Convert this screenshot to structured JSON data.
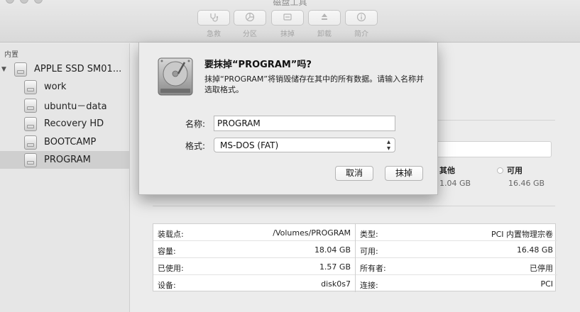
{
  "window": {
    "title": "磁盘工具"
  },
  "toolbar": {
    "buttons": [
      {
        "label": "急救",
        "icon": "stethoscope-icon"
      },
      {
        "label": "分区",
        "icon": "partition-pie-icon"
      },
      {
        "label": "抹掉",
        "icon": "erase-icon"
      },
      {
        "label": "卸载",
        "icon": "unmount-icon"
      },
      {
        "label": "简介",
        "icon": "info-icon"
      }
    ]
  },
  "sidebar": {
    "section_header": "内置",
    "device": "APPLE SSD SM01...",
    "items": [
      {
        "label": "work"
      },
      {
        "label": "ubuntu－data"
      },
      {
        "label": "Recovery HD"
      },
      {
        "label": "BOOTCAMP"
      },
      {
        "label": "PROGRAM"
      }
    ],
    "selected": "PROGRAM"
  },
  "usage": {
    "other_label": "其他",
    "other_value": "1.04 GB",
    "free_label": "可用",
    "free_value": "16.46 GB"
  },
  "info": {
    "left": [
      {
        "key": "装载点:",
        "value": "/Volumes/PROGRAM"
      },
      {
        "key": "容量:",
        "value": "18.04 GB"
      },
      {
        "key": "已使用:",
        "value": "1.57 GB"
      },
      {
        "key": "设备:",
        "value": "disk0s7"
      }
    ],
    "right": [
      {
        "key": "类型:",
        "value": "PCI 内置物理宗卷"
      },
      {
        "key": "可用:",
        "value": "16.48 GB"
      },
      {
        "key": "所有者:",
        "value": "已停用"
      },
      {
        "key": "连接:",
        "value": "PCI"
      }
    ]
  },
  "dialog": {
    "title": "要抹掉“PROGRAM”吗?",
    "message": "抹掉“PROGRAM”将销毁储存在其中的所有数据。请输入名称并选取格式。",
    "name_label": "名称:",
    "name_value": "PROGRAM",
    "format_label": "格式:",
    "format_value": "MS-DOS (FAT)",
    "cancel_label": "取消",
    "erase_label": "抹掉"
  }
}
